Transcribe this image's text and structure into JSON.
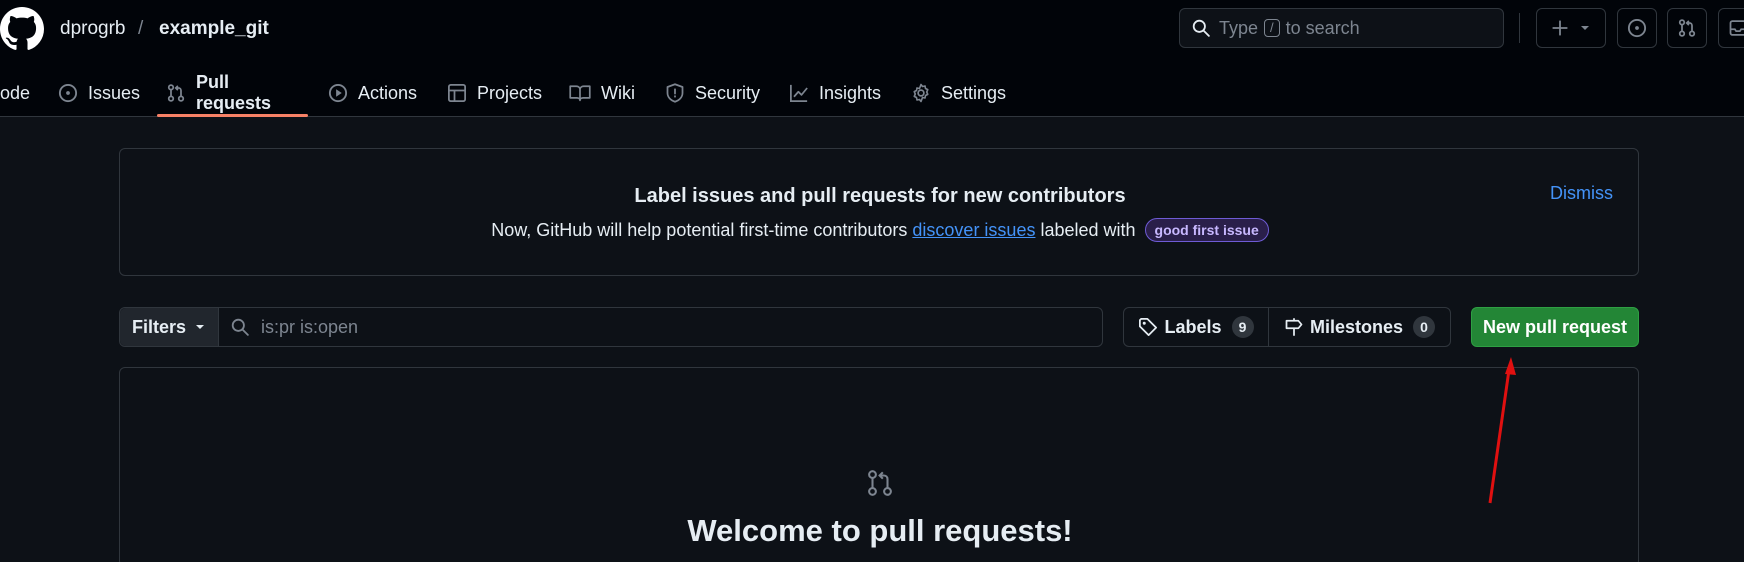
{
  "header": {
    "owner": "dprogrb",
    "separator": "/",
    "repo": "example_git",
    "search_prefix": "Type",
    "search_key": "/",
    "search_suffix": "to search"
  },
  "nav": {
    "items": [
      {
        "label": "Code",
        "visible_text": "ode"
      },
      {
        "label": "Issues"
      },
      {
        "label": "Pull requests"
      },
      {
        "label": "Actions"
      },
      {
        "label": "Projects"
      },
      {
        "label": "Wiki"
      },
      {
        "label": "Security"
      },
      {
        "label": "Insights"
      },
      {
        "label": "Settings"
      }
    ],
    "active": "Pull requests"
  },
  "banner": {
    "title": "Label issues and pull requests for new contributors",
    "text_before": "Now, GitHub will help potential first-time contributors ",
    "link": "discover issues",
    "text_after": " labeled with ",
    "label_chip": "good first issue",
    "dismiss": "Dismiss"
  },
  "toolbar": {
    "filters_label": "Filters",
    "filter_value": "is:pr is:open",
    "labels_label": "Labels",
    "labels_count": "9",
    "milestones_label": "Milestones",
    "milestones_count": "0",
    "new_pr_label": "New pull request"
  },
  "blankslate": {
    "title": "Welcome to pull requests!"
  },
  "colors": {
    "background": "#0d1117",
    "header": "#010409",
    "border": "#30363d",
    "link": "#4493f8",
    "primary_button": "#238636",
    "active_underline": "#f78166",
    "annotation_arrow": "#e01010"
  },
  "icons": [
    "github-logo-icon",
    "search-icon",
    "plus-icon",
    "chevron-down-icon",
    "issue-icon",
    "pull-request-icon",
    "inbox-icon",
    "code-icon",
    "play-icon",
    "table-icon",
    "book-icon",
    "shield-icon",
    "graph-icon",
    "gear-icon",
    "tag-icon",
    "milestone-icon"
  ]
}
